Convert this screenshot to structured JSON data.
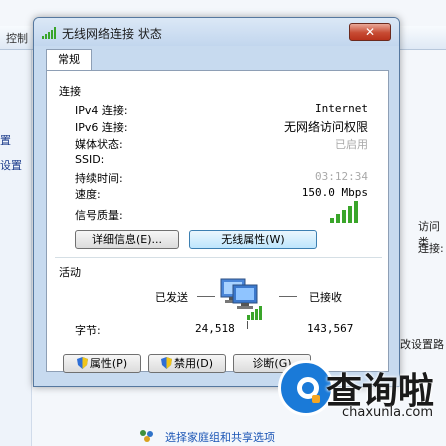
{
  "background": {
    "toolbar_left": "控制",
    "toolbar_right": "",
    "left_items": [
      "置",
      "设置"
    ],
    "right_labels": [
      "访问类",
      "连接:",
      "改设置路"
    ],
    "bottom_link": "选择家庭组和共享选项"
  },
  "dialog": {
    "title": "无线网络连接 状态",
    "close_label": "✕",
    "tab": "常规",
    "connection": {
      "heading": "连接",
      "rows": [
        {
          "label": "IPv4 连接:",
          "value": "Internet"
        },
        {
          "label": "IPv6 连接:",
          "value": "无网络访问权限"
        },
        {
          "label": "媒体状态:",
          "value": "已启用"
        },
        {
          "label": "SSID:",
          "value": ""
        },
        {
          "label": "持续时间:",
          "value": "03:12:34"
        },
        {
          "label": "速度:",
          "value": "150.0 Mbps"
        }
      ],
      "signal_label": "信号质量:",
      "signal_level": "5/5"
    },
    "buttons": {
      "details": "详细信息(E)...",
      "wireless_props": "无线属性(W)"
    },
    "activity": {
      "heading": "活动",
      "sent_label": "已发送",
      "received_label": "已接收",
      "bytes_label": "字节:",
      "bytes_sent": "24,518",
      "bytes_received": "143,567"
    },
    "footer_buttons": {
      "properties": "属性(P)",
      "disable": "禁用(D)",
      "diagnose": "诊断(G)"
    }
  },
  "watermark": {
    "brand": "查询啦",
    "url": "chaxunla.com"
  },
  "colors": {
    "signal": "#3aa52a",
    "close": "#c74b33",
    "brand": "#1a7ad8"
  }
}
